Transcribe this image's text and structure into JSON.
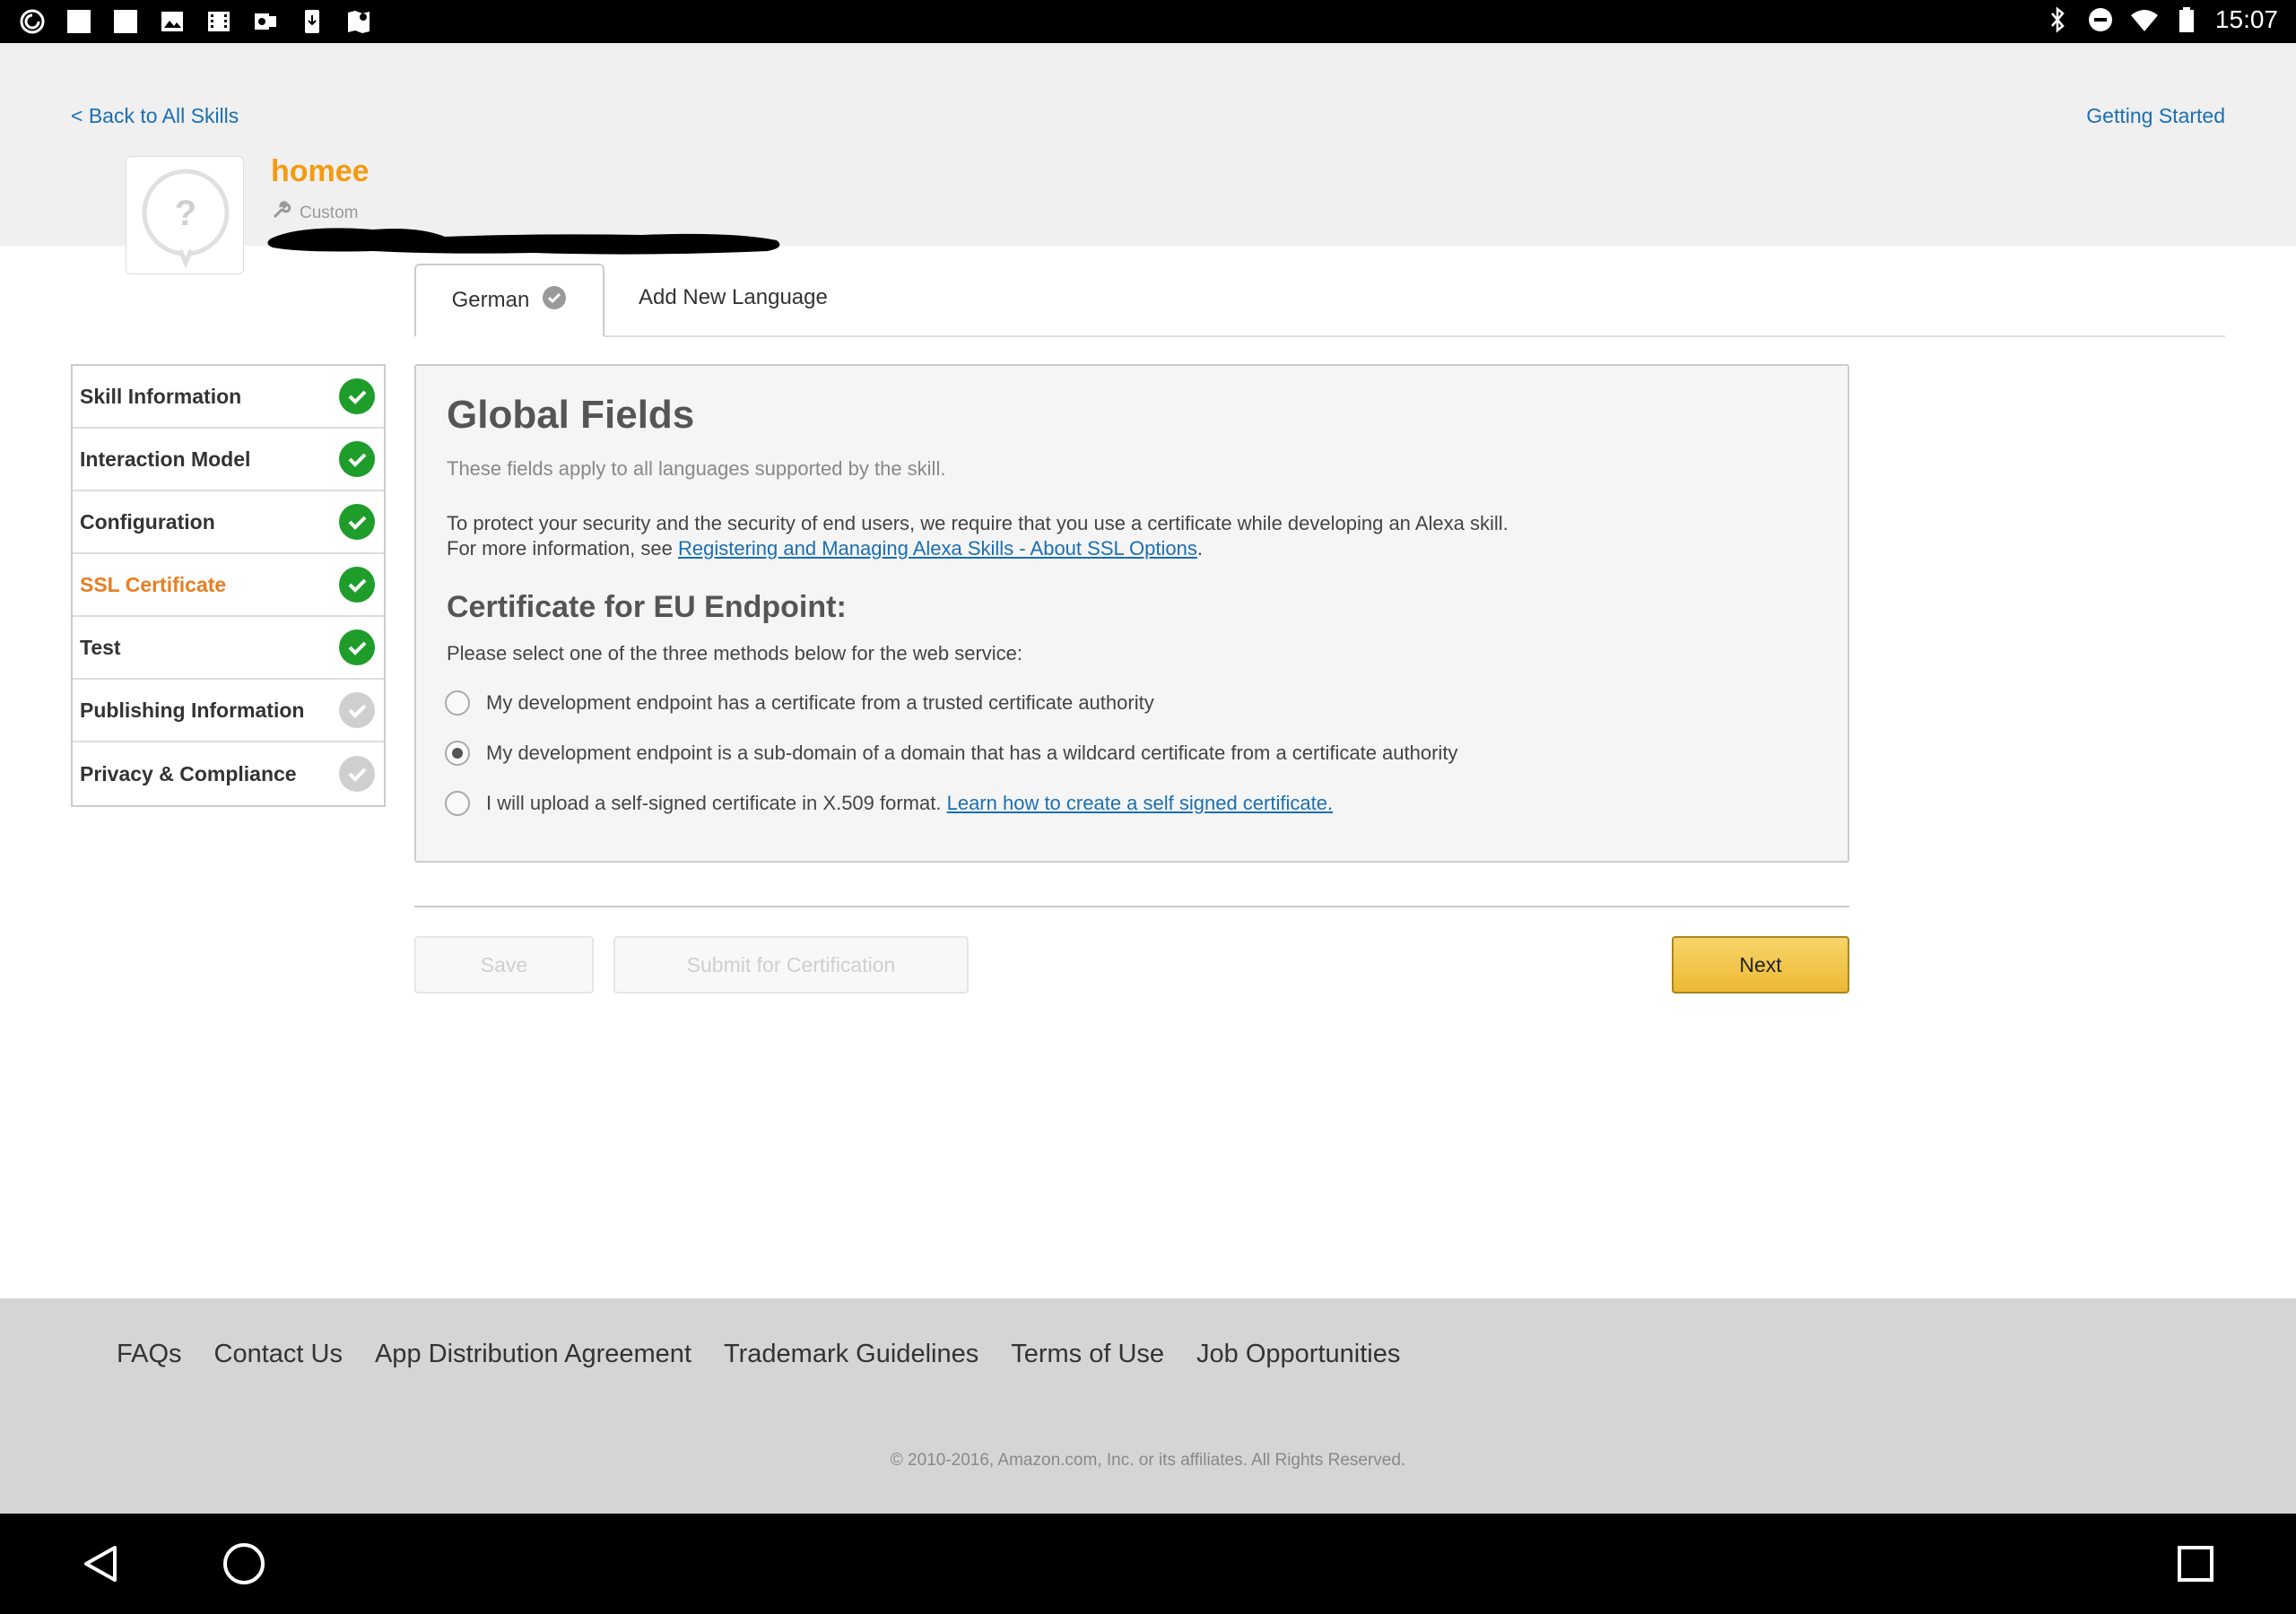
{
  "status_bar": {
    "time": "15:07",
    "left_icons": [
      "app-swirl-icon",
      "notification-square-icon",
      "notification-square-icon",
      "image-icon",
      "film-icon",
      "outlook-icon",
      "download-icon",
      "maps-icon"
    ],
    "right_icons": [
      "bluetooth-icon",
      "do-not-disturb-icon",
      "wifi-icon",
      "battery-icon"
    ]
  },
  "header": {
    "back_link": "< Back to All Skills",
    "getting_started": "Getting Started",
    "skill_name": "homee",
    "skill_type": "Custom",
    "icon_glyph": "?"
  },
  "tabs": {
    "active": "German",
    "add": "Add New Language"
  },
  "sidebar": {
    "items": [
      {
        "label": "Skill Information",
        "status": "done"
      },
      {
        "label": "Interaction Model",
        "status": "done"
      },
      {
        "label": "Configuration",
        "status": "done"
      },
      {
        "label": "SSL Certificate",
        "status": "done",
        "active": true
      },
      {
        "label": "Test",
        "status": "done"
      },
      {
        "label": "Publishing Information",
        "status": "pending"
      },
      {
        "label": "Privacy & Compliance",
        "status": "pending"
      }
    ]
  },
  "panel": {
    "title": "Global Fields",
    "subtitle": "These fields apply to all languages supported by the skill.",
    "intro_line1": "To protect your security and the security of end users, we require that you use a certificate while developing an Alexa skill.",
    "intro_line2_prefix": "For more information, see ",
    "intro_link": "Registering and Managing Alexa Skills - About SSL Options",
    "intro_line2_suffix": ".",
    "cert_heading": "Certificate for EU Endpoint:",
    "question": "Please select one of the three methods below for the web service:",
    "options": [
      {
        "label": "My development endpoint has a certificate from a trusted certificate authority",
        "selected": false
      },
      {
        "label": "My development endpoint is a sub-domain of a domain that has a wildcard certificate from a certificate authority",
        "selected": true
      },
      {
        "label": "I will upload a self-signed certificate in X.509 format. ",
        "link": "Learn how to create a self signed certificate.",
        "selected": false
      }
    ]
  },
  "buttons": {
    "save": "Save",
    "submit": "Submit for Certification",
    "next": "Next"
  },
  "footer": {
    "links": [
      "FAQs",
      "Contact Us",
      "App Distribution Agreement",
      "Trademark Guidelines",
      "Terms of Use",
      "Job Opportunities"
    ],
    "copyright": "© 2010-2016, Amazon.com, Inc. or its affiliates. All Rights Reserved."
  },
  "colors": {
    "link": "#1a6fb3",
    "brand_orange": "#f39c12",
    "check_green": "#1f9d2a",
    "next_button": "#eeb933"
  }
}
